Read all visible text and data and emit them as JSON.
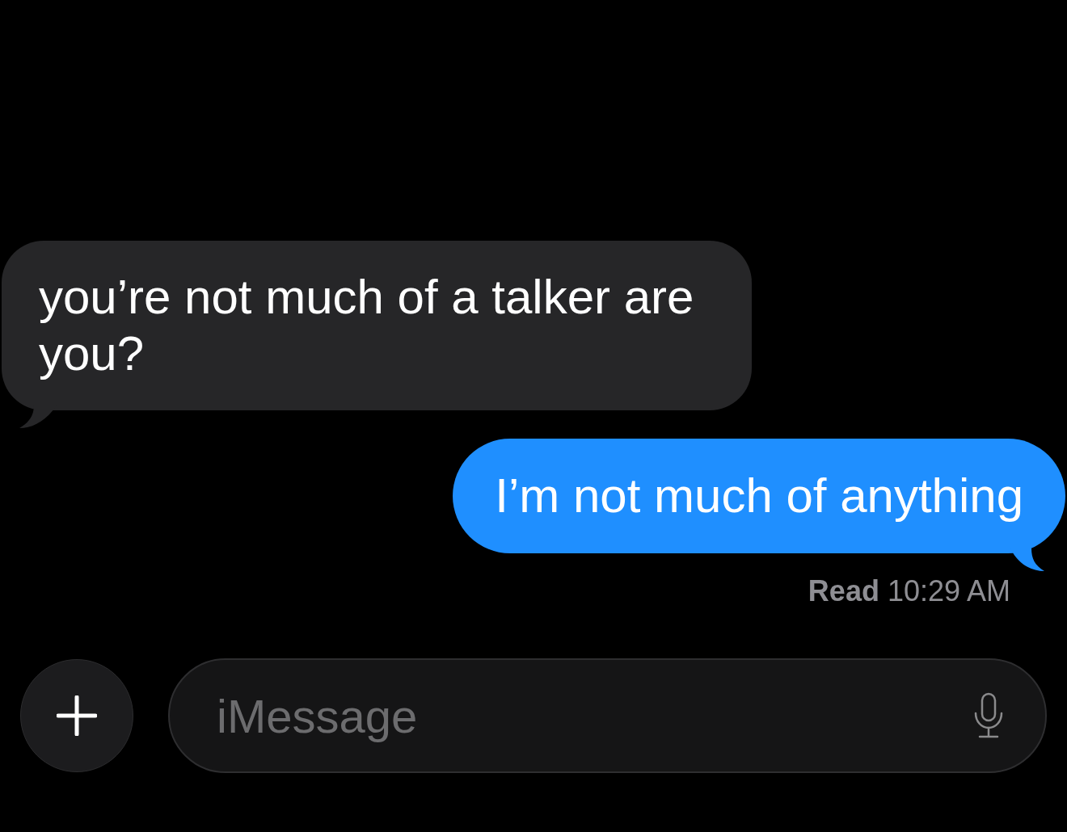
{
  "messages": [
    {
      "kind": "incoming",
      "text": "you’re not much of a talker are you?"
    },
    {
      "kind": "outgoing",
      "text": "I’m not much of anything"
    }
  ],
  "receipt": {
    "text": "**Read** 10:29 AM"
  },
  "composer": {
    "placeholder": "iMessage"
  }
}
